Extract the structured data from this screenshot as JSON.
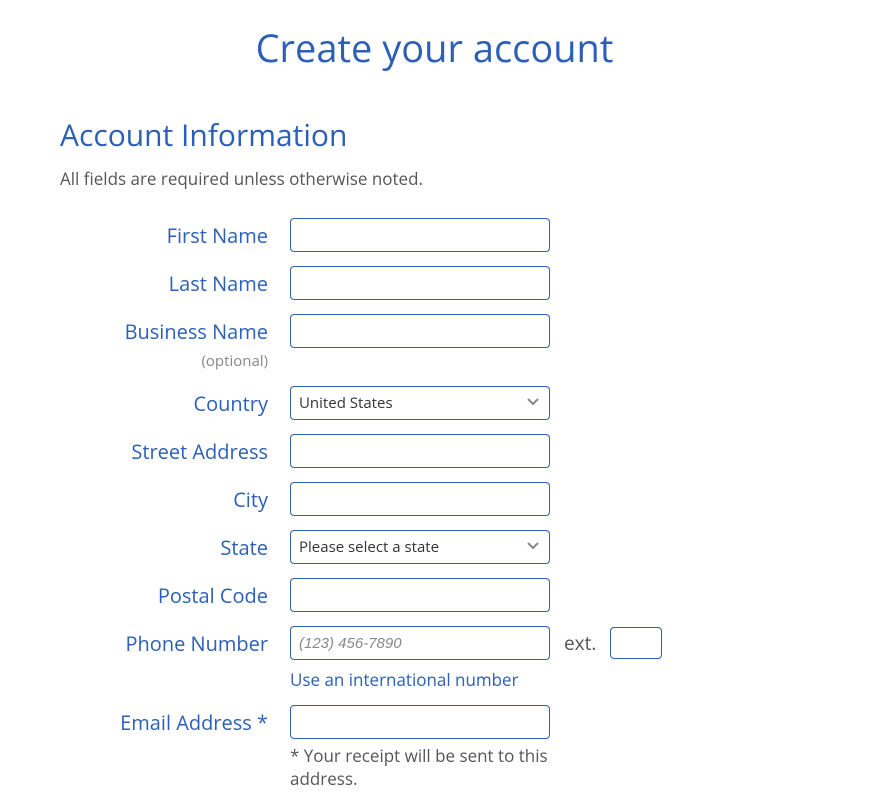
{
  "page_title": "Create your account",
  "section_title": "Account Information",
  "required_note": "All fields are required unless otherwise noted.",
  "fields": {
    "first_name": {
      "label": "First Name",
      "value": ""
    },
    "last_name": {
      "label": "Last Name",
      "value": ""
    },
    "business_name": {
      "label": "Business Name",
      "optional_text": "(optional)",
      "value": ""
    },
    "country": {
      "label": "Country",
      "value": "United States"
    },
    "street": {
      "label": "Street Address",
      "value": ""
    },
    "city": {
      "label": "City",
      "value": ""
    },
    "state": {
      "label": "State",
      "value": "Please select a state"
    },
    "postal": {
      "label": "Postal Code",
      "value": ""
    },
    "phone": {
      "label": "Phone Number",
      "placeholder": "(123) 456-7890",
      "value": "",
      "ext_label": "ext.",
      "ext_value": "",
      "intl_link": "Use an international number"
    },
    "email": {
      "label": "Email Address *",
      "value": "",
      "note": "* Your receipt will be sent to this address."
    }
  }
}
